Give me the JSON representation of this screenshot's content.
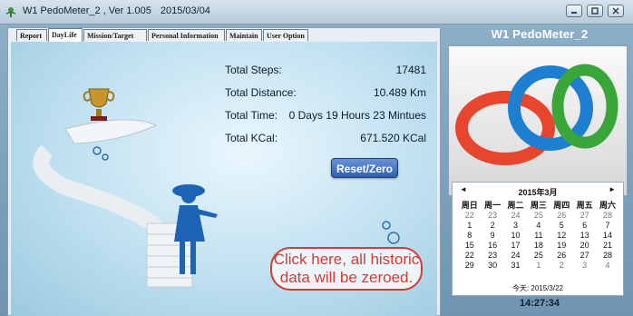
{
  "window": {
    "title": "W1 PedoMeter_2 , Ver 1.005",
    "date": "2015/03/04"
  },
  "tabs": [
    {
      "label": "Report"
    },
    {
      "label": "DayLife"
    },
    {
      "label": "Mission/Target"
    },
    {
      "label": "Personal Information"
    },
    {
      "label": "Maintain"
    },
    {
      "label": "User Option"
    }
  ],
  "stats": {
    "total_steps_label": "Total Steps:",
    "total_steps_value": "17481",
    "total_distance_label": "Total Distance:",
    "total_distance_value": "10.489 Km",
    "total_time_label": "Total Time:",
    "total_time_value": "0 Days 19 Hours 23 Mintues",
    "total_kcal_label": "Total KCal:",
    "total_kcal_value": "671.520 KCal"
  },
  "reset_button": {
    "label": "Reset/Zero"
  },
  "callout": {
    "line1": "Click here, all historic",
    "line2": "data will be zeroed."
  },
  "product": {
    "title": "W1 PedoMeter_2"
  },
  "calendar": {
    "month": "2015年3月",
    "weekdays": [
      "周日",
      "周一",
      "周二",
      "周三",
      "周四",
      "周五",
      "周六"
    ],
    "weeks": [
      [
        "22",
        "23",
        "24",
        "25",
        "26",
        "27",
        "28"
      ],
      [
        "1",
        "2",
        "3",
        "4",
        "5",
        "6",
        "7"
      ],
      [
        "8",
        "9",
        "10",
        "11",
        "12",
        "13",
        "14"
      ],
      [
        "15",
        "16",
        "17",
        "18",
        "19",
        "20",
        "21"
      ],
      [
        "22",
        "23",
        "24",
        "25",
        "26",
        "27",
        "28"
      ],
      [
        "29",
        "30",
        "31",
        "1",
        "2",
        "3",
        "4"
      ]
    ],
    "today": "今天: 2015/3/22"
  },
  "clock": "14:27:34",
  "colors": {
    "accent": "#2f5fae",
    "callout": "#d23c32"
  }
}
